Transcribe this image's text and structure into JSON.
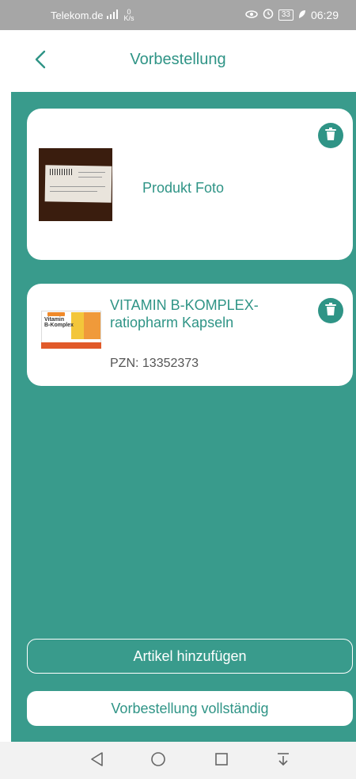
{
  "status_bar": {
    "carrier": "Telekom.de",
    "network_speed_value": "0",
    "network_speed_unit": "K/s",
    "battery": "33",
    "time": "06:29"
  },
  "header": {
    "title": "Vorbestellung"
  },
  "items": [
    {
      "label": "Produkt Foto"
    },
    {
      "name": "VITAMIN B-KOMPLEX-ratiopharm Kapseln",
      "pzn": "PZN: 13352373"
    }
  ],
  "actions": {
    "add_label": "Artikel hinzufügen",
    "complete_label": "Vorbestellung vollständig"
  },
  "colors": {
    "accent": "#2f9486",
    "background": "#399b8c"
  },
  "icons": {
    "back": "chevron-left-icon",
    "delete": "trash-icon"
  }
}
